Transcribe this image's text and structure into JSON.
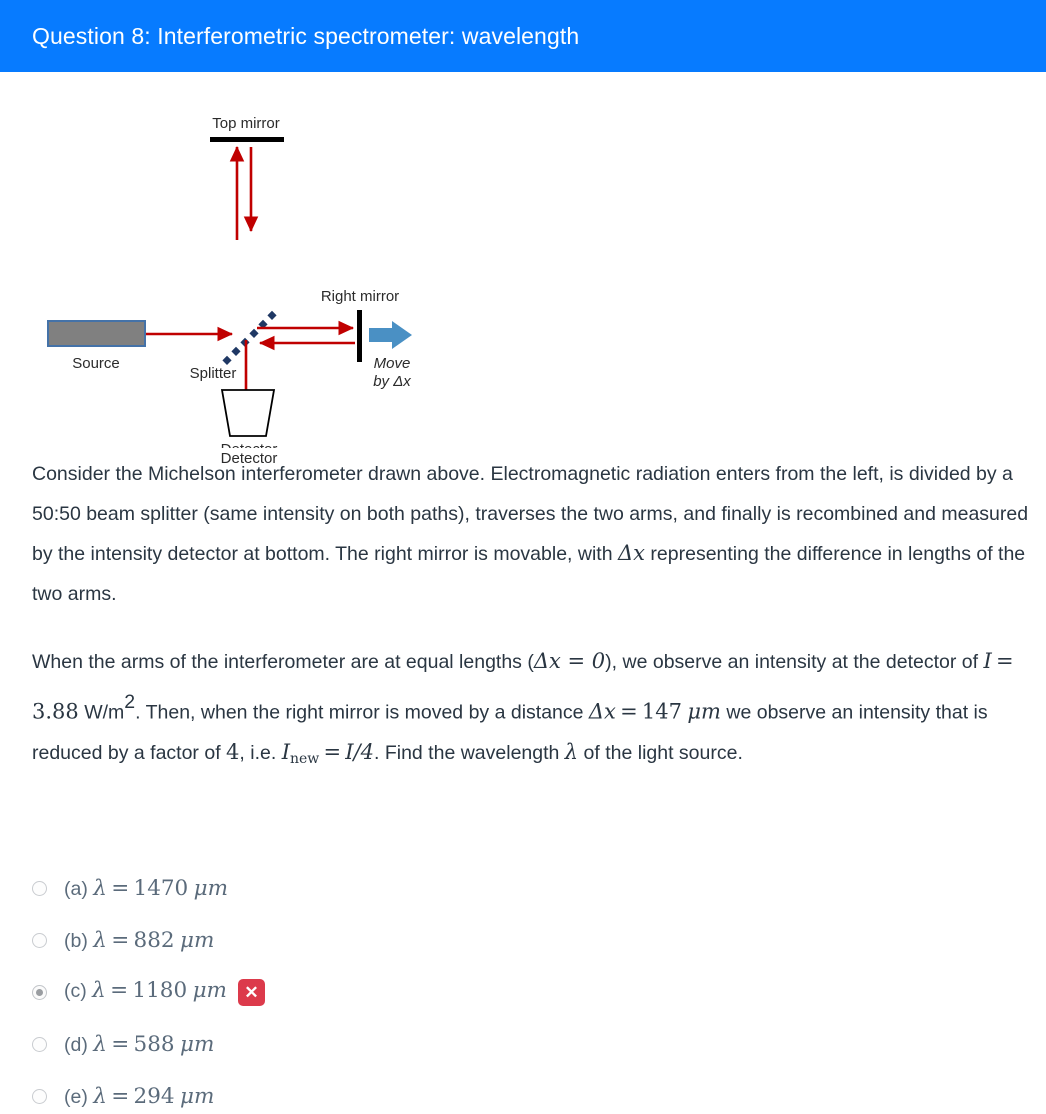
{
  "header": {
    "title": "Question 8: Interferometric spectrometer: wavelength",
    "background_color": "#077bff",
    "text_color": "#ffffff"
  },
  "figure": {
    "name": "michelson-interferometer-diagram",
    "labels": {
      "top_mirror": "Top mirror",
      "right_mirror": "Right mirror",
      "source": "Source",
      "splitter": "Splitter",
      "detector": "Detector",
      "move_line1": "Move",
      "move_line2": "by Δx"
    },
    "colors": {
      "beam": "#c00000",
      "splitter_dots": "#1f3864",
      "source_fill": "#808080",
      "source_border": "#4472a8",
      "move_arrow": "#4a90c4",
      "mirror": "#000000"
    }
  },
  "body": {
    "paragraph1": {
      "part1": "Consider the Michelson interferometer drawn above. Electromagnetic radiation enters from the left, is divided by a 50:50 beam splitter (same intensity on both paths), traverses the two arms, and finally is recombined and measured by the intensity detector at bottom. The right mirror is movable, with ",
      "math_dx": "Δx",
      "part2": " representing the difference in lengths of the two arms."
    },
    "paragraph2": {
      "part1": "When the arms of the interferometer are at equal lengths (",
      "math_dx_eq_zero": "Δx = 0",
      "part2": "), we observe an intensity at the detector of ",
      "math_I": "I",
      "math_eq": "=",
      "math_I_value": "3.88",
      "units_I": "W/m",
      "units_exp": "2",
      "part3": ". Then, when the right mirror is moved by a distance ",
      "math_dx2": "Δx",
      "math_dx_value": "147",
      "units_dx": "μm",
      "part4": " we observe an intensity that is reduced by a factor of ",
      "math_factor": "4",
      "part5": ", i.e. ",
      "math_Inew": "I",
      "math_Inew_sub": "new",
      "math_Inew_value": "I/4",
      "part6": ". Find the wavelength ",
      "math_lambda": "λ",
      "part7": " of the light source."
    }
  },
  "options": [
    {
      "letter": "(a)",
      "symbol": "λ",
      "eq": "=",
      "value": "1470",
      "unit": "μm",
      "selected": false,
      "badge": null
    },
    {
      "letter": "(b)",
      "symbol": "λ",
      "eq": "=",
      "value": "882",
      "unit": "μm",
      "selected": false,
      "badge": null
    },
    {
      "letter": "(c)",
      "symbol": "λ",
      "eq": "=",
      "value": "1180",
      "unit": "μm",
      "selected": true,
      "badge": "✕"
    },
    {
      "letter": "(d)",
      "symbol": "λ",
      "eq": "=",
      "value": "588",
      "unit": "μm",
      "selected": false,
      "badge": null
    },
    {
      "letter": "(e)",
      "symbol": "λ",
      "eq": "=",
      "value": "294",
      "unit": "μm",
      "selected": false,
      "badge": null
    }
  ]
}
